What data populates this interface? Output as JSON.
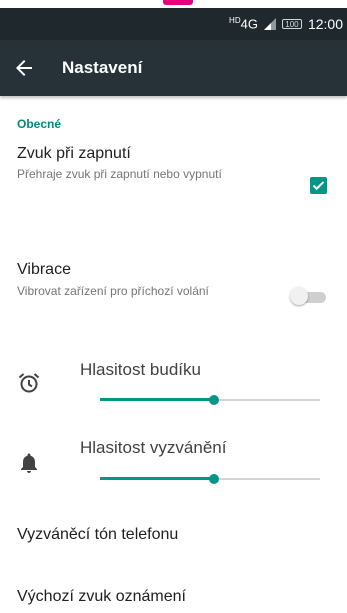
{
  "status_bar": {
    "network": "4G",
    "network_prefix": "HD",
    "battery": "100",
    "time": "12:00"
  },
  "toolbar": {
    "title": "Nastavení",
    "back_icon": "arrow-left-icon"
  },
  "section": {
    "header": "Obecné"
  },
  "settings": {
    "boot_sound": {
      "title": "Zvuk při zapnutí",
      "subtitle": "Přehraje zvuk při zapnutí nebo vypnutí",
      "checked": true
    },
    "vibration": {
      "title": "Vibrace",
      "subtitle": "Vibrovat zařízení pro příchozí volání",
      "enabled": false
    }
  },
  "volumes": [
    {
      "label": "Hlasitost budíku",
      "icon": "alarm-clock-icon",
      "level": 0.52
    },
    {
      "label": "Hlasitost vyzvánění",
      "icon": "bell-icon",
      "level": 0.52
    }
  ],
  "menu": {
    "ringtone": "Vyzváněcí tón telefonu",
    "notification_sound": "Výchozí zvuk oznámení"
  },
  "colors": {
    "accent": "#009688",
    "toolbar": "#263238",
    "status_bar": "#1f292d",
    "brand_mark": "#e6007e"
  }
}
